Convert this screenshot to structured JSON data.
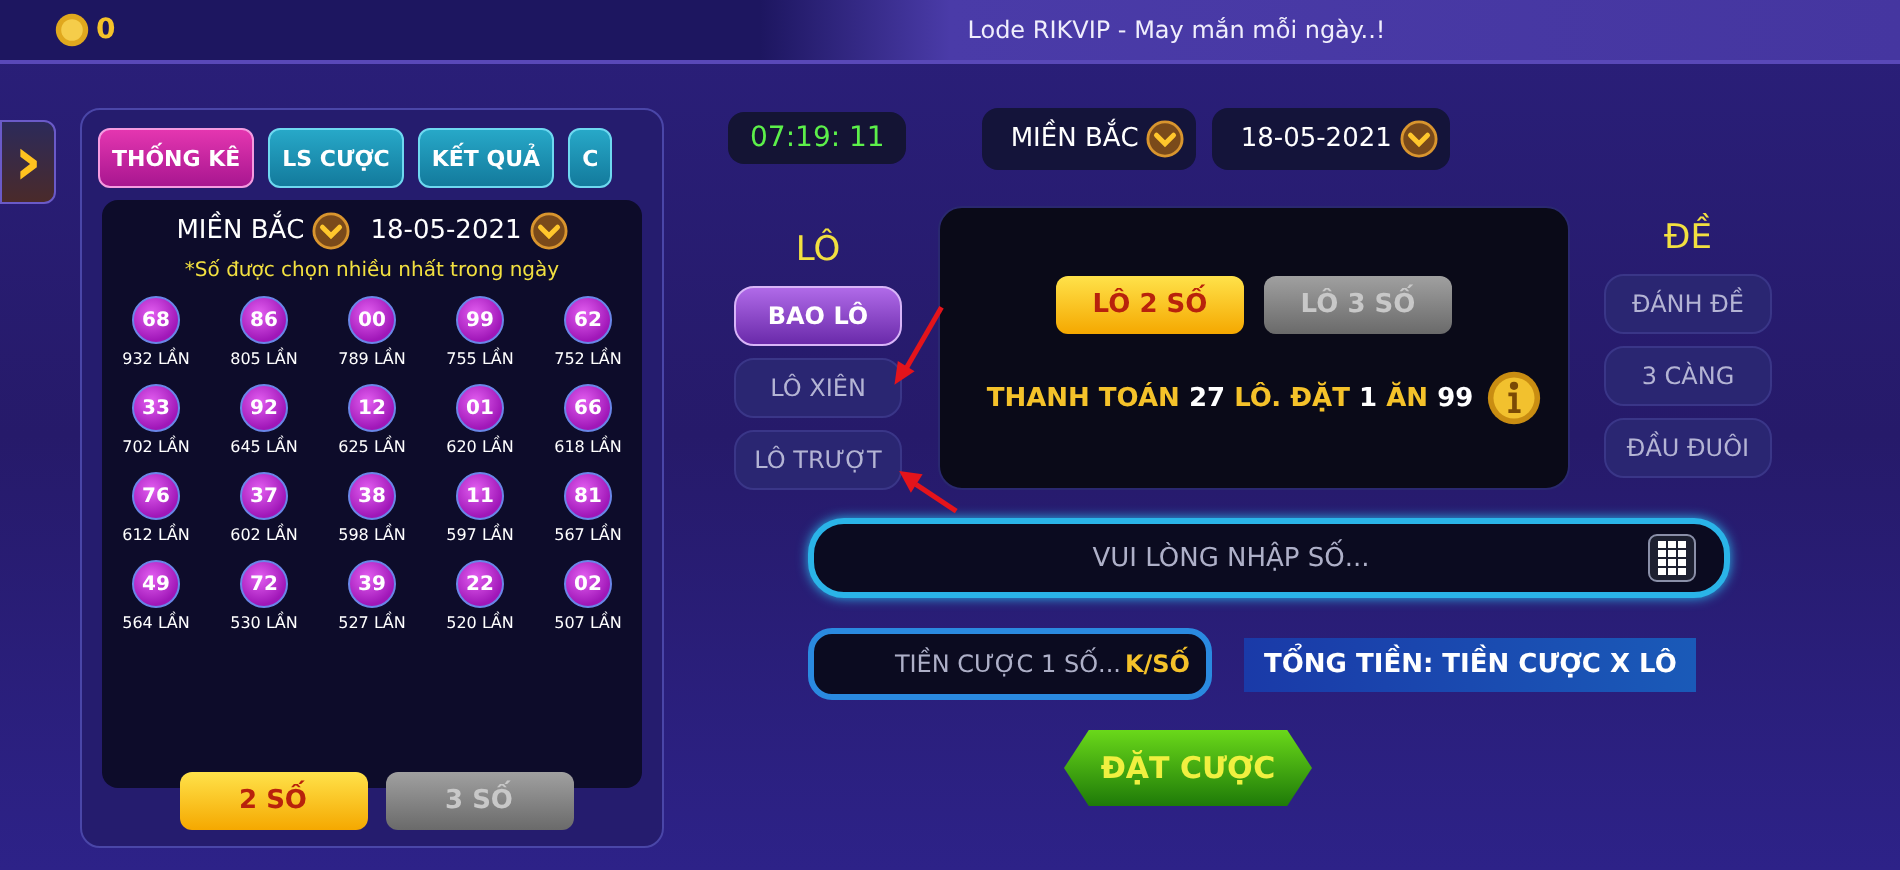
{
  "top_bar": {
    "balance": "0",
    "title": "Lode RIKVIP - May mắn mỗi ngày..!"
  },
  "side_toggle": {
    "icon": "›"
  },
  "tabs": [
    {
      "label": "THỐNG KÊ",
      "selected": true
    },
    {
      "label": "LS CƯỢC",
      "selected": false
    },
    {
      "label": "KẾT QUẢ",
      "selected": false
    },
    {
      "label": "C",
      "selected": false
    }
  ],
  "stats": {
    "region": "MIỀN BẮC",
    "date": "18-05-2021",
    "hint": "*Số được chọn nhiều nhất trong ngày",
    "numbers": [
      {
        "number": "68",
        "count": "932 LẦN"
      },
      {
        "number": "86",
        "count": "805 LẦN"
      },
      {
        "number": "00",
        "count": "789 LẦN"
      },
      {
        "number": "99",
        "count": "755 LẦN"
      },
      {
        "number": "62",
        "count": "752 LẦN"
      },
      {
        "number": "33",
        "count": "702 LẦN"
      },
      {
        "number": "92",
        "count": "645 LẦN"
      },
      {
        "number": "12",
        "count": "625 LẦN"
      },
      {
        "number": "01",
        "count": "620 LẦN"
      },
      {
        "number": "66",
        "count": "618 LẦN"
      },
      {
        "number": "76",
        "count": "612 LẦN"
      },
      {
        "number": "37",
        "count": "602 LẦN"
      },
      {
        "number": "38",
        "count": "598 LẦN"
      },
      {
        "number": "11",
        "count": "597 LẦN"
      },
      {
        "number": "81",
        "count": "567 LẦN"
      },
      {
        "number": "49",
        "count": "564 LẦN"
      },
      {
        "number": "72",
        "count": "530 LẦN"
      },
      {
        "number": "39",
        "count": "527 LẦN"
      },
      {
        "number": "22",
        "count": "520 LẦN"
      },
      {
        "number": "02",
        "count": "507 LẦN"
      }
    ],
    "digit_options": [
      {
        "label": "2 SỐ",
        "selected": true
      },
      {
        "label": "3 SỐ",
        "selected": false
      }
    ]
  },
  "clock": "07:19: 11",
  "selectors": {
    "region": "MIỀN BẮC",
    "date": "18-05-2021"
  },
  "lo": {
    "title": "LÔ",
    "options": [
      {
        "label": "BAO LÔ",
        "selected": true
      },
      {
        "label": "LÔ XIÊN",
        "selected": false
      },
      {
        "label": "LÔ TRƯỢT",
        "selected": false
      }
    ]
  },
  "bet_panel": {
    "types": [
      {
        "label": "LÔ 2 SỐ",
        "selected": true
      },
      {
        "label": "LÔ 3 SỐ",
        "selected": false
      }
    ],
    "payout": [
      {
        "text": "THANH TOÁN",
        "highlight": false
      },
      {
        "text": "27",
        "highlight": true
      },
      {
        "text": "LÔ. ĐẶT",
        "highlight": false
      },
      {
        "text": "1",
        "highlight": true
      },
      {
        "text": "ĂN",
        "highlight": false
      },
      {
        "text": "99",
        "highlight": true
      }
    ]
  },
  "de": {
    "title": "ĐỀ",
    "options": [
      {
        "label": "ĐÁNH ĐỀ",
        "selected": false
      },
      {
        "label": "3 CÀNG",
        "selected": false
      },
      {
        "label": "ĐẦU ĐUÔI",
        "selected": false
      }
    ]
  },
  "number_field": {
    "placeholder": "VUI LÒNG NHẬP SỐ..."
  },
  "stake_field": {
    "placeholder": "TIỀN CƯỢC 1 SỐ...",
    "unit": "K/SỐ"
  },
  "total_note": "TỔNG TIỀN: TIỀN CƯỢC X LÔ",
  "submit": "ĐẶT CƯỢC"
}
